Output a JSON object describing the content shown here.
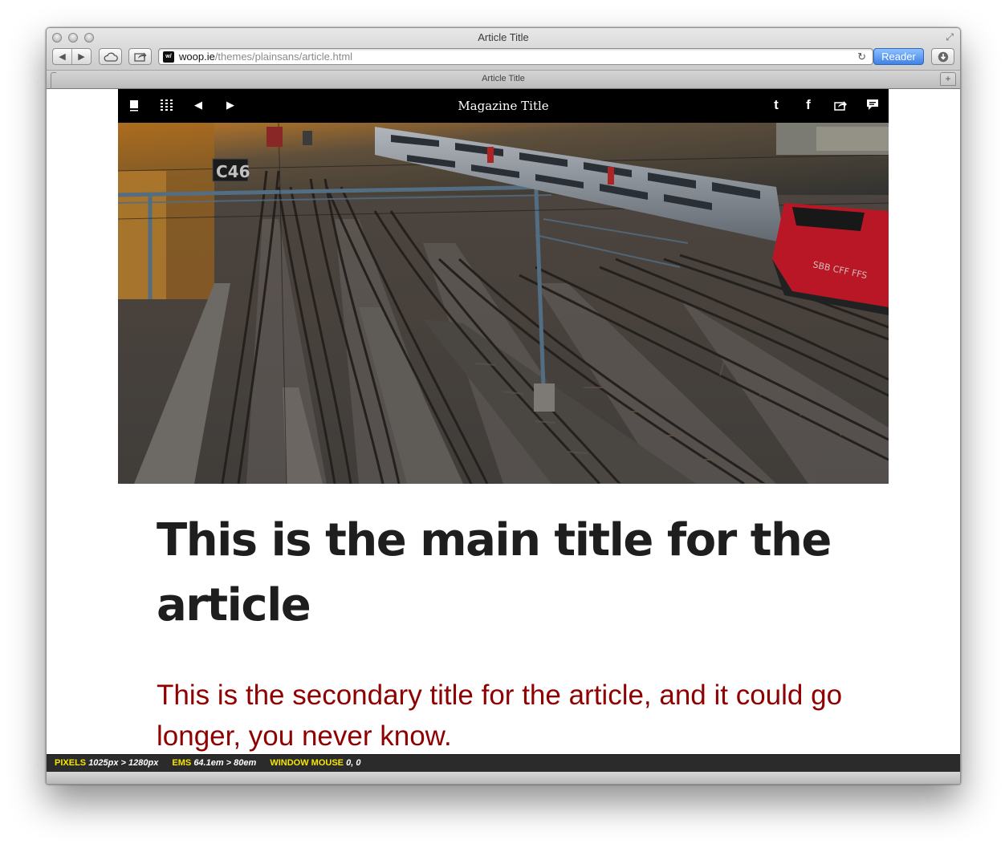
{
  "window": {
    "title": "Article Title"
  },
  "toolbar": {
    "url_host": "woop.ie",
    "url_path": "/themes/plainsans/article.html",
    "favicon_text": "w/",
    "reader_label": "Reader",
    "icons": {
      "back": "back-arrow-icon",
      "forward": "forward-arrow-icon",
      "icloud": "icloud-icon",
      "share": "share-icon",
      "reload": "reload-icon",
      "download": "download-icon",
      "resize": "fullscreen-icon"
    }
  },
  "tabs": [
    {
      "label": "Article Title",
      "active": true
    }
  ],
  "magazine": {
    "title": "Magazine Title",
    "left_icons": [
      "book-icon",
      "grid-icon",
      "previous-icon",
      "next-icon"
    ],
    "right_icons": [
      "twitter-icon",
      "facebook-icon",
      "share-icon",
      "comment-icon"
    ]
  },
  "hero": {
    "sign_text": "C46",
    "locomotive_text": "SBB CFF FFS"
  },
  "article": {
    "main_title": "This is the main title for the article",
    "subtitle": "This is the secondary title for the article, and it could go longer, you never know."
  },
  "debug": {
    "pixels_label": "PIXELS",
    "pixels_value": "1025px > 1280px",
    "ems_label": "EMS",
    "ems_value": "64.1em > 80em",
    "mouse_label": "WINDOW MOUSE",
    "mouse_value": "0, 0"
  },
  "colors": {
    "accent": "#8f0000",
    "title": "#1e1e1e",
    "reader_button": "#3e82e6",
    "debug_key": "#f5e600",
    "magazine_bar": "#000000"
  }
}
